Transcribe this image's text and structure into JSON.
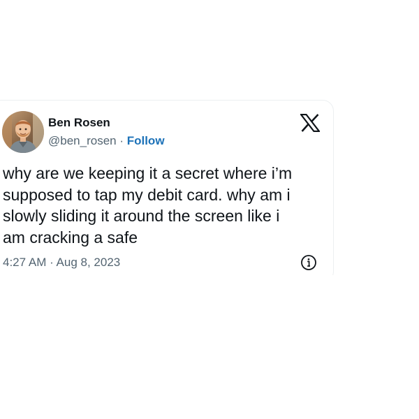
{
  "tweet": {
    "author_name": "Ben Rosen",
    "handle": "@ben_rosen",
    "separator": " · ",
    "follow_label": "Follow",
    "text": "why are we keeping it a secret where i’m\nsupposed to tap my debit card. why am i\nslowly sliding it around the screen like i\nam cracking a safe",
    "timestamp": "4:27 AM · Aug 8, 2023"
  },
  "icons": {
    "platform_logo": "x-logo-icon",
    "info": "info-icon",
    "avatar": "avatar"
  },
  "colors": {
    "text_primary": "#0f1419",
    "text_secondary": "#536471",
    "link": "#1d72b8",
    "card_border": "#eceff1"
  }
}
